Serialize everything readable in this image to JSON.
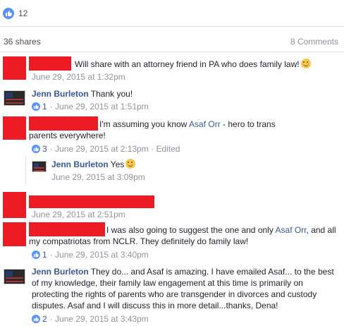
{
  "summary": {
    "likes": "12",
    "shares": "36 shares",
    "comments": "8 Comments"
  },
  "comments": [
    {
      "text": "Will share with an attorney friend in PA who does family law!",
      "meta": "June 29, 2015 at 1:32pm"
    },
    {
      "author": "Jenn Burleton",
      "text": "Thank you!",
      "likes": "1",
      "meta": "· June 29, 2015 at 1:51pm"
    },
    {
      "text_before": "I'm assuming you know ",
      "link": "Asaf Orr",
      "text_after": " - hero to trans parents everywhere!",
      "likes": "3",
      "meta": "· June 29, 2015 at 2:13pm · Edited"
    },
    {
      "author": "Jenn Burleton",
      "text": "Yes",
      "meta": "June 29, 2015 at 3:09pm"
    },
    {
      "meta": "June 29, 2015 at 2:51pm"
    },
    {
      "text_before": "I was also going to suggest the one and only ",
      "link": "Asaf Orr",
      "text_after": ", and all my compatriotas from NCLR. They definitely do family law!",
      "likes": "1",
      "meta": "· June 29, 2015 at 3:40pm"
    },
    {
      "author": "Jenn Burleton",
      "text": "They do... and Asaf is amazing. I have emailed Asaf... to the best of my knowledge, their family law engagement at this time is primarily on protecting the rights of parents who are transgender in divorces and custody disputes. Asaf and I will discuss this in more detail...thanks, Dena!",
      "likes": "2",
      "meta": "· June 29, 2015 at 3:43pm"
    }
  ],
  "colors": {
    "link": "#365899",
    "meta": "#90949c",
    "like": "#5890ff",
    "redaction": "#ed1c24"
  },
  "icons": [
    "like-icon",
    "smile-emoji-icon",
    "avatar-flag-icon"
  ]
}
